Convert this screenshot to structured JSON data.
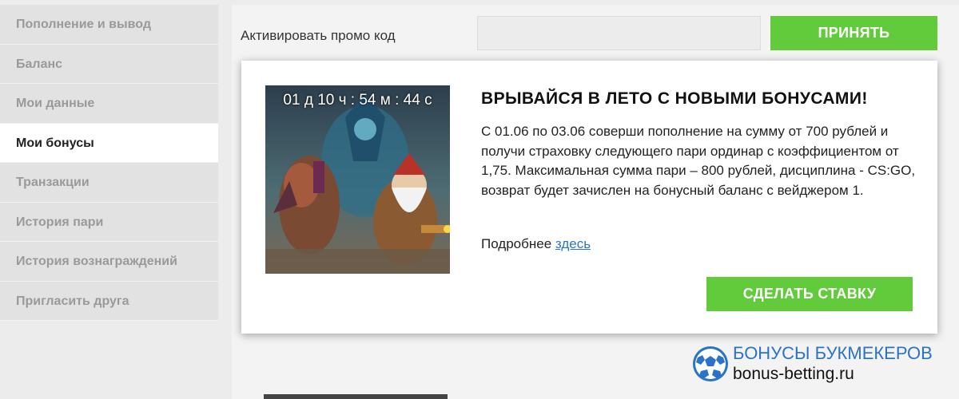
{
  "sidebar": {
    "items": [
      {
        "label": "Пополнение и вывод",
        "active": false
      },
      {
        "label": "Баланс",
        "active": false
      },
      {
        "label": "Мои данные",
        "active": false
      },
      {
        "label": "Мои бонусы",
        "active": true
      },
      {
        "label": "Транзакции",
        "active": false
      },
      {
        "label": "История пари",
        "active": false
      },
      {
        "label": "История вознаграждений",
        "active": false
      },
      {
        "label": "Пригласить друга",
        "active": false
      }
    ]
  },
  "promo": {
    "label": "Активировать промо код",
    "input_value": "",
    "accept_label": "ПРИНЯТЬ"
  },
  "card": {
    "timer": "01 д  10 ч : 54 м : 44 с",
    "title": "ВРЫВАЙСЯ В ЛЕТО С НОВЫМИ БОНУСАМИ!",
    "description": "С 01.06 по 03.06 соверши пополнение на сумму от 700 рублей и получи страховку следующего пари ординар с коэффициентом от 1,75. Максимальная сумма пари – 800 рублей, дисциплина - CS:GO, возврат будет зачислен на бонусный баланс с вейджером 1.",
    "more_text": "Подробнее",
    "more_link": "здесь",
    "bet_label": "СДЕЛАТЬ СТАВКУ"
  },
  "watermark": {
    "title": "БОНУСЫ БУКМЕКЕРОВ",
    "url": "bonus-betting.ru"
  },
  "colors": {
    "accent_green": "#62cb3b",
    "link_blue": "#2a77c9",
    "watermark_blue": "#2a73c6"
  },
  "icons": {
    "watermark_logo": "soccer-ball-icon"
  }
}
